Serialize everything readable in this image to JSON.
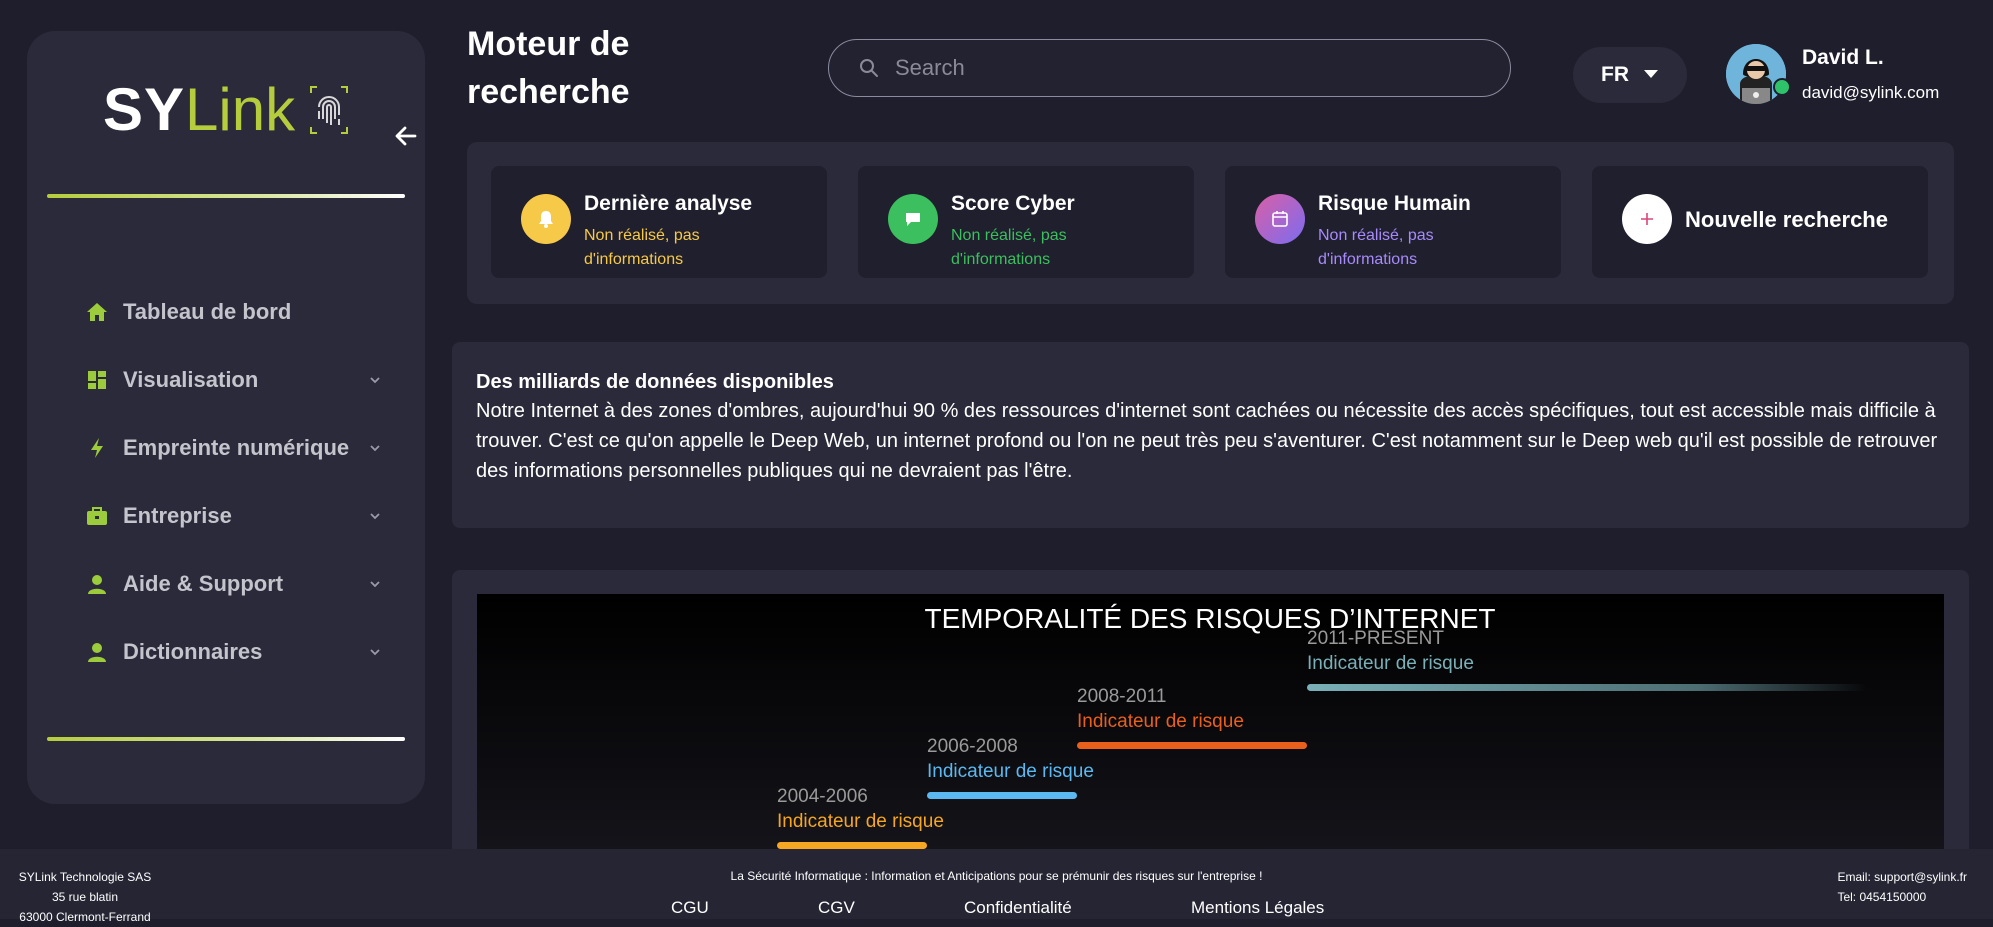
{
  "brand": {
    "logo_part1": "SY",
    "logo_part2": "Link",
    "accent": "#b5cc3c"
  },
  "sidebar": {
    "items": [
      {
        "label": "Tableau de bord",
        "icon": "home-icon",
        "expandable": false
      },
      {
        "label": "Visualisation",
        "icon": "dashboard-grid-icon",
        "expandable": true
      },
      {
        "label": "Empreinte numérique",
        "icon": "lightning-icon",
        "expandable": true
      },
      {
        "label": "Entreprise",
        "icon": "briefcase-icon",
        "expandable": true
      },
      {
        "label": "Aide & Support",
        "icon": "user-icon",
        "expandable": true
      },
      {
        "label": "Dictionnaires",
        "icon": "user-icon",
        "expandable": true
      }
    ]
  },
  "header": {
    "title": "Moteur de recherche",
    "search_placeholder": "Search",
    "language": "FR",
    "user": {
      "name": "David L.",
      "email": "david@sylink.com",
      "status": "online"
    }
  },
  "stats": [
    {
      "title": "Dernière analyse",
      "subtitle": "Non réalisé, pas d'informations",
      "color": "#f7c948",
      "icon": "bell-icon"
    },
    {
      "title": "Score Cyber",
      "subtitle": "Non réalisé, pas d'informations",
      "color": "#3cbf5e",
      "icon": "chat-icon"
    },
    {
      "title": "Risque Humain",
      "subtitle": "Non réalisé, pas d'informations",
      "color": "#a78bfa",
      "icon": "calendar-icon"
    }
  ],
  "new_search": {
    "label": "Nouvelle recherche"
  },
  "info": {
    "title": "Des milliards de données disponibles",
    "text": "Notre Internet à des zones d'ombres, aujourd'hui 90 % des ressources d'internet sont cachées ou nécessite des accès spécifiques, tout est accessible mais difficile à trouver. C'est ce qu'on appelle le Deep Web, un internet profond ou l'on ne peut très peu s'aventurer. C'est notamment sur le Deep web qu'il est possible de retrouver des informations personnelles publiques qui ne devraient pas l'être."
  },
  "chart_data": {
    "type": "timeline",
    "title": "TEMPORALITÉ DES RISQUES D’INTERNET",
    "periods": [
      {
        "period": "2004-2006",
        "label": "Indicateur de risque",
        "color": "#f5a623"
      },
      {
        "period": "2006-2008",
        "label": "Indicateur de risque",
        "color": "#5bb8f0"
      },
      {
        "period": "2008-2011",
        "label": "Indicateur de risque",
        "color": "#e8601c"
      },
      {
        "period": "2011-PRESENT",
        "label": "Indicateur de risque",
        "color": "#7ab0b8"
      }
    ]
  },
  "footer": {
    "company": "SYLink Technologie SAS",
    "address1": "35 rue blatin",
    "address2": "63000 Clermont-Ferrand",
    "tagline": "La Sécurité Informatique : Information et Anticipations pour se prémunir des risques sur l'entreprise !",
    "links": [
      "CGU",
      "CGV",
      "Confidentialité",
      "Mentions Légales"
    ],
    "email": "Email: support@sylink.fr",
    "phone": "Tel: 0454150000"
  }
}
